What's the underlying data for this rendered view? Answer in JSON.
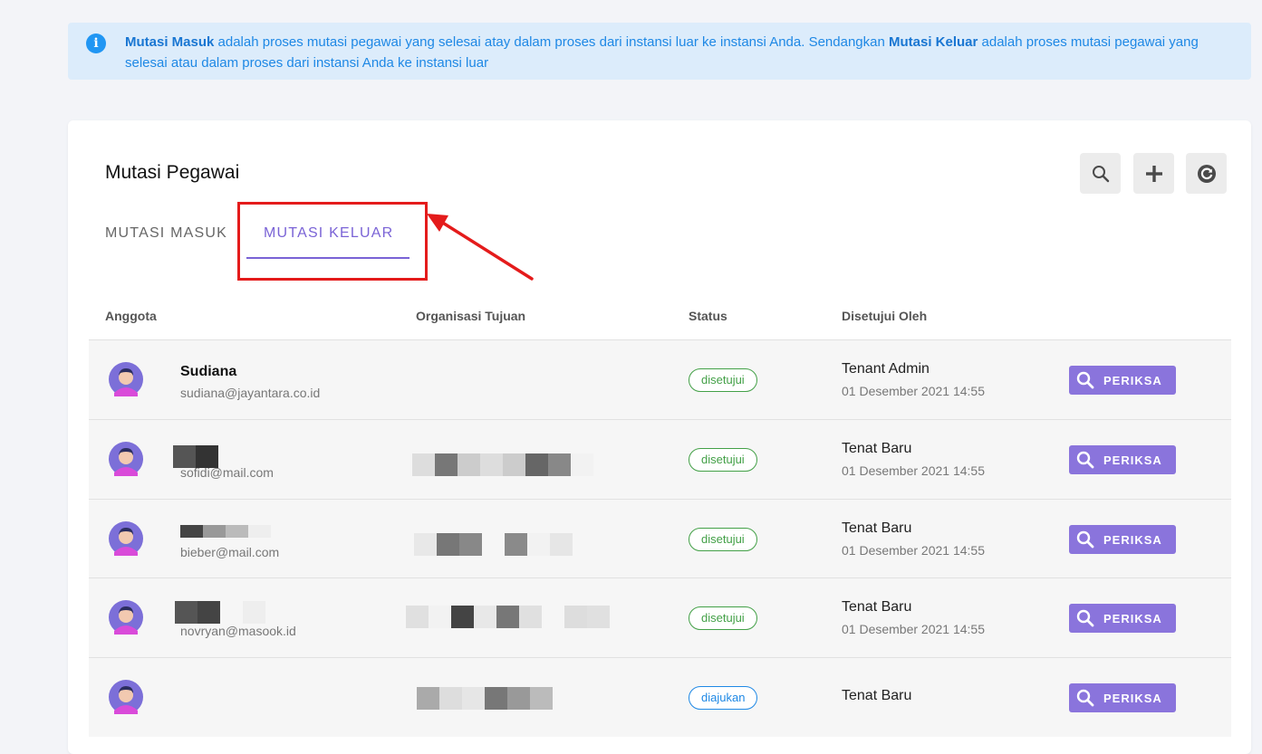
{
  "info_banner": {
    "icon": "info-icon",
    "strong_1": "Mutasi Masuk",
    "text_1": " adalah proses mutasi pegawai yang selesai atay dalam proses dari instansi luar ke instansi Anda. Sendangkan ",
    "strong_2": "Mutasi Keluar",
    "text_2": " adalah proses mutasi pegawai yang selesai atau dalam proses dari instansi Anda ke instansi luar"
  },
  "card": {
    "title": "Mutasi Pegawai",
    "actions": [
      "search-icon",
      "plus-icon",
      "refresh-icon"
    ],
    "tabs": [
      {
        "label": "MUTASI MASUK",
        "active": false
      },
      {
        "label": "MUTASI KELUAR",
        "active": true
      }
    ]
  },
  "table": {
    "headers": [
      "Anggota",
      "Organisasi Tujuan",
      "Status",
      "Disetujui Oleh"
    ],
    "action_label": "PERIKSA",
    "rows": [
      {
        "name": "Sudiana",
        "email": "sudiana@jayantara.co.id",
        "status": "disetujui",
        "approver": "Tenant Admin",
        "date": "01 Desember 2021 14:55"
      },
      {
        "name": "",
        "email": "sofidi@mail.com",
        "status": "disetujui",
        "approver": "Tenat Baru",
        "date": "01 Desember 2021 14:55"
      },
      {
        "name": "",
        "email": "bieber@mail.com",
        "status": "disetujui",
        "approver": "Tenat Baru",
        "date": "01 Desember 2021 14:55"
      },
      {
        "name": "",
        "email": "novryan@masook.id",
        "status": "disetujui",
        "approver": "Tenat Baru",
        "date": "01 Desember 2021 14:55"
      },
      {
        "name": "",
        "email": "",
        "status": "diajukan",
        "approver": "Tenat Baru",
        "date": ""
      }
    ]
  },
  "colors": {
    "accent": "#7a63d6",
    "button": "#8a74dc",
    "approved": "#43a047",
    "submitted": "#1e88e5",
    "annotation": "#e41b1b"
  }
}
